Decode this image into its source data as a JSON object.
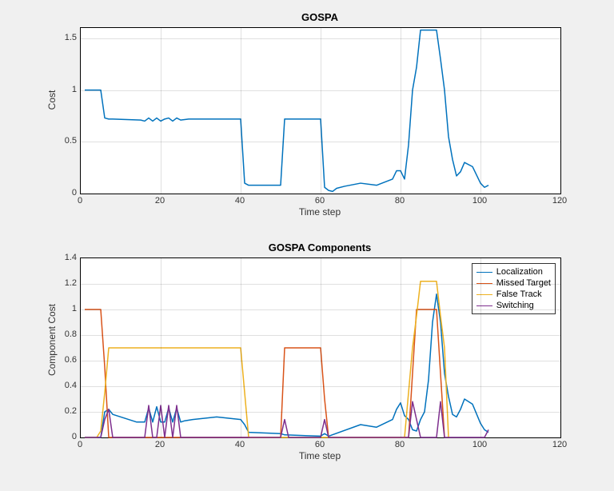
{
  "top": {
    "title": "GOSPA",
    "xlabel": "Time step",
    "ylabel": "Cost",
    "xlim": [
      0,
      120
    ],
    "ylim": [
      0,
      1.6
    ],
    "xticks": [
      0,
      20,
      40,
      60,
      80,
      100,
      120
    ],
    "yticks": [
      0,
      0.5,
      1,
      1.5
    ]
  },
  "bottom": {
    "title": "GOSPA Components",
    "xlabel": "Time step",
    "ylabel": "Component Cost",
    "xlim": [
      0,
      120
    ],
    "ylim": [
      0,
      1.4
    ],
    "xticks": [
      0,
      20,
      40,
      60,
      80,
      100,
      120
    ],
    "yticks": [
      0,
      0.2,
      0.4,
      0.6,
      0.8,
      1,
      1.2,
      1.4
    ],
    "legend": [
      "Localization",
      "Missed Target",
      "False Track",
      "Switching"
    ]
  },
  "colors": {
    "c1": "#0072BD",
    "c2": "#D95319",
    "c3": "#EDB120",
    "c4": "#7E2F8E"
  },
  "chart_data": [
    {
      "type": "line",
      "title": "GOSPA",
      "xlabel": "Time step",
      "ylabel": "Cost",
      "xlim": [
        0,
        120
      ],
      "ylim": [
        0,
        1.6
      ],
      "series": [
        {
          "name": "GOSPA",
          "x": [
            1,
            2,
            3,
            4,
            5,
            6,
            7,
            8,
            15,
            16,
            17,
            18,
            19,
            20,
            21,
            22,
            23,
            24,
            25,
            27,
            40,
            41,
            42,
            50,
            51,
            52,
            60,
            61,
            62,
            63,
            64,
            66,
            70,
            74,
            78,
            79,
            80,
            81,
            82,
            83,
            84,
            85,
            86,
            87,
            88,
            89,
            90,
            91,
            92,
            93,
            94,
            95,
            96,
            98,
            100,
            101,
            102
          ],
          "y": [
            1.0,
            1.0,
            1.0,
            1.0,
            1.0,
            0.73,
            0.72,
            0.72,
            0.71,
            0.7,
            0.73,
            0.7,
            0.73,
            0.7,
            0.72,
            0.73,
            0.7,
            0.73,
            0.71,
            0.72,
            0.72,
            0.1,
            0.08,
            0.08,
            0.72,
            0.72,
            0.72,
            0.06,
            0.03,
            0.02,
            0.05,
            0.07,
            0.1,
            0.08,
            0.14,
            0.22,
            0.22,
            0.14,
            0.47,
            1.0,
            1.22,
            1.58,
            1.58,
            1.58,
            1.58,
            1.58,
            1.3,
            1.0,
            0.55,
            0.33,
            0.17,
            0.21,
            0.3,
            0.26,
            0.1,
            0.06,
            0.08
          ]
        }
      ]
    },
    {
      "type": "line",
      "title": "GOSPA Components",
      "xlabel": "Time step",
      "ylabel": "Component Cost",
      "xlim": [
        0,
        120
      ],
      "ylim": [
        0,
        1.4
      ],
      "legend_pos": "upper-right",
      "series": [
        {
          "name": "Localization",
          "x": [
            1,
            5,
            6,
            7,
            8,
            14,
            16,
            17,
            18,
            19,
            20,
            21,
            22,
            23,
            24,
            25,
            26,
            28,
            34,
            40,
            41,
            42,
            50,
            51,
            60,
            61,
            62,
            70,
            74,
            78,
            79,
            80,
            81,
            82,
            83,
            84,
            85,
            86,
            87,
            88,
            89,
            90,
            91,
            92,
            93,
            94,
            95,
            96,
            98,
            100,
            101,
            102
          ],
          "y": [
            0,
            0,
            0.2,
            0.22,
            0.18,
            0.12,
            0.12,
            0.23,
            0.12,
            0.24,
            0.12,
            0.12,
            0.23,
            0.12,
            0.23,
            0.12,
            0.13,
            0.14,
            0.16,
            0.14,
            0.1,
            0.04,
            0.03,
            0.02,
            0.01,
            0.03,
            0.01,
            0.1,
            0.08,
            0.14,
            0.22,
            0.27,
            0.17,
            0.14,
            0.06,
            0.05,
            0.14,
            0.2,
            0.45,
            0.9,
            1.12,
            0.9,
            0.5,
            0.32,
            0.18,
            0.16,
            0.22,
            0.3,
            0.26,
            0.11,
            0.06,
            0.04
          ]
        },
        {
          "name": "Missed Target",
          "x": [
            1,
            2,
            5,
            6,
            7,
            50,
            51,
            52,
            60,
            61,
            62,
            82,
            83,
            84,
            89,
            90,
            91
          ],
          "y": [
            1.0,
            1.0,
            1.0,
            0.55,
            0.0,
            0.0,
            0.7,
            0.7,
            0.7,
            0.3,
            0.0,
            0.0,
            0.5,
            1.0,
            1.0,
            0.5,
            0.0
          ]
        },
        {
          "name": "False Track",
          "x": [
            1,
            4,
            5,
            6,
            7,
            8,
            40,
            41,
            42,
            81,
            82,
            83,
            84,
            85,
            89,
            90,
            91,
            92
          ],
          "y": [
            0,
            0,
            0.05,
            0.35,
            0.7,
            0.7,
            0.7,
            0.35,
            0.0,
            0.0,
            0.35,
            0.7,
            0.95,
            1.22,
            1.22,
            0.95,
            0.7,
            0.0
          ]
        },
        {
          "name": "Switching",
          "x": [
            1,
            5,
            6,
            7,
            8,
            16,
            17,
            18,
            19,
            20,
            21,
            22,
            23,
            24,
            25,
            50,
            51,
            52,
            60,
            61,
            62,
            82,
            83,
            84,
            85,
            89,
            90,
            91,
            101,
            102
          ],
          "y": [
            0,
            0,
            0.14,
            0.22,
            0.0,
            0.0,
            0.25,
            0.0,
            0.0,
            0.25,
            0.0,
            0.25,
            0.0,
            0.25,
            0.0,
            0.0,
            0.14,
            0.0,
            0.0,
            0.14,
            0.0,
            0.0,
            0.28,
            0.14,
            0.0,
            0.0,
            0.28,
            0.0,
            0.0,
            0.06
          ]
        }
      ]
    }
  ]
}
